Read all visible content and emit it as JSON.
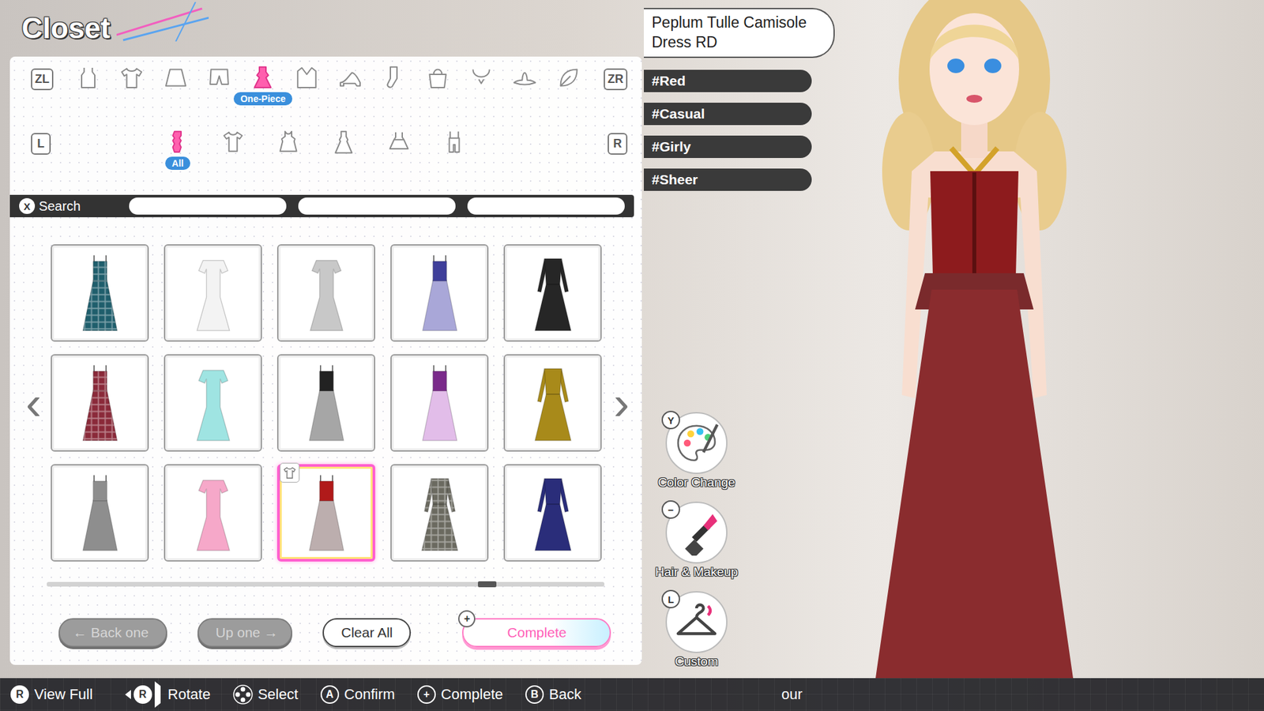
{
  "screen_title": "Closet",
  "category_nav": {
    "prev_key": "ZL",
    "next_key": "ZR",
    "items": [
      {
        "kind": "tank",
        "selected": false
      },
      {
        "kind": "tshirt",
        "selected": false
      },
      {
        "kind": "skirt",
        "selected": false
      },
      {
        "kind": "shorts",
        "selected": false
      },
      {
        "kind": "dress",
        "selected": true,
        "label": "One-Piece"
      },
      {
        "kind": "jacket",
        "selected": false
      },
      {
        "kind": "heels",
        "selected": false
      },
      {
        "kind": "socks",
        "selected": false
      },
      {
        "kind": "bag",
        "selected": false
      },
      {
        "kind": "necklace",
        "selected": false
      },
      {
        "kind": "hat",
        "selected": false
      },
      {
        "kind": "leaf",
        "selected": false
      }
    ]
  },
  "sub_nav": {
    "prev_key": "L",
    "next_key": "R",
    "items": [
      {
        "kind": "all",
        "selected": true,
        "label": "All"
      },
      {
        "kind": "shirtdress",
        "selected": false
      },
      {
        "kind": "shortdress",
        "selected": false
      },
      {
        "kind": "longdress",
        "selected": false
      },
      {
        "kind": "babydoll",
        "selected": false
      },
      {
        "kind": "overall",
        "selected": false
      }
    ]
  },
  "search": {
    "key": "X",
    "label": "Search",
    "fields": [
      "",
      "",
      ""
    ]
  },
  "grid": {
    "prev_arrow": "‹",
    "next_arrow": "›",
    "scroll": {
      "level": 0.8
    },
    "items": [
      {
        "kind": "strap",
        "color": "#1f5e6c",
        "accent": "#1f5e6c",
        "plaid": true,
        "selected": false,
        "equipped": false
      },
      {
        "kind": "sleeve-mermaid",
        "color": "#f3f3f3",
        "accent": "#f3f3f3",
        "plaid": false,
        "selected": false,
        "equipped": false
      },
      {
        "kind": "sleeve-mermaid",
        "color": "#c8c8c8",
        "accent": "#c8c8c8",
        "plaid": false,
        "selected": false,
        "equipped": false
      },
      {
        "kind": "strap",
        "color": "#a9a7d8",
        "accent": "#3f3f9a",
        "plaid": false,
        "selected": false,
        "equipped": false
      },
      {
        "kind": "long-sleeve",
        "color": "#262626",
        "accent": "#262626",
        "plaid": false,
        "selected": false,
        "equipped": false
      },
      {
        "kind": "strap",
        "color": "#8a2a3a",
        "accent": "#8a2a3a",
        "plaid": true,
        "selected": false,
        "equipped": false
      },
      {
        "kind": "sleeve-mermaid",
        "color": "#9fe4e2",
        "accent": "#9fe4e2",
        "plaid": false,
        "selected": false,
        "equipped": false
      },
      {
        "kind": "strap",
        "color": "#a6a6a6",
        "accent": "#222222",
        "plaid": false,
        "selected": false,
        "equipped": false
      },
      {
        "kind": "strap",
        "color": "#e2bde9",
        "accent": "#7a2a8a",
        "plaid": false,
        "selected": false,
        "equipped": false
      },
      {
        "kind": "long-sleeve",
        "color": "#a88a1a",
        "accent": "#a88a1a",
        "plaid": false,
        "selected": false,
        "equipped": false
      },
      {
        "kind": "strap",
        "color": "#8e8e8e",
        "accent": "#8e8e8e",
        "plaid": false,
        "selected": false,
        "equipped": false
      },
      {
        "kind": "sleeve-mermaid",
        "color": "#f6a8c9",
        "accent": "#f6a8c9",
        "plaid": false,
        "selected": false,
        "equipped": false
      },
      {
        "kind": "strap",
        "color": "#bcaeae",
        "accent": "#b01a1a",
        "plaid": false,
        "selected": true,
        "equipped": true
      },
      {
        "kind": "long-sleeve",
        "color": "#6b6a60",
        "accent": "#6b6a60",
        "plaid": true,
        "selected": false,
        "equipped": false
      },
      {
        "kind": "long-sleeve",
        "color": "#2a2d7a",
        "accent": "#2a2d7a",
        "plaid": false,
        "selected": false,
        "equipped": false
      }
    ]
  },
  "buttons": [
    {
      "prefix": "←",
      "label": "Back one",
      "suffix": "",
      "disabled": true,
      "kind": "plain"
    },
    {
      "prefix": "",
      "label": "Up one",
      "suffix": "→",
      "disabled": true,
      "kind": "plain"
    },
    {
      "prefix": "",
      "label": "Clear All",
      "suffix": "",
      "disabled": false,
      "kind": "plain"
    },
    {
      "prefix": "",
      "label": "Complete",
      "suffix": "",
      "disabled": false,
      "kind": "primary",
      "badge": "+"
    }
  ],
  "item_info": {
    "name": "Peplum Tulle Camisole Dress RD",
    "tags": [
      "#Red",
      "#Casual",
      "#Girly",
      "#Sheer"
    ]
  },
  "side_tools": [
    {
      "key": "Y",
      "label": "Color Change",
      "kind": "palette"
    },
    {
      "key": "−",
      "label": "Hair & Makeup",
      "kind": "lipstick"
    },
    {
      "key": "L",
      "label": "Custom",
      "kind": "hanger"
    }
  ],
  "hints": [
    {
      "kind": "stick",
      "key": "R",
      "label": "View Full"
    },
    {
      "kind": "stick-rotate",
      "key": "R",
      "label": "Rotate"
    },
    {
      "kind": "dpad",
      "label": "Select"
    },
    {
      "kind": "button",
      "key": "A",
      "label": "Confirm"
    },
    {
      "kind": "button",
      "key": "+",
      "label": "Complete"
    },
    {
      "kind": "button",
      "key": "B",
      "label": "Back"
    }
  ],
  "hint_trailing": "our"
}
